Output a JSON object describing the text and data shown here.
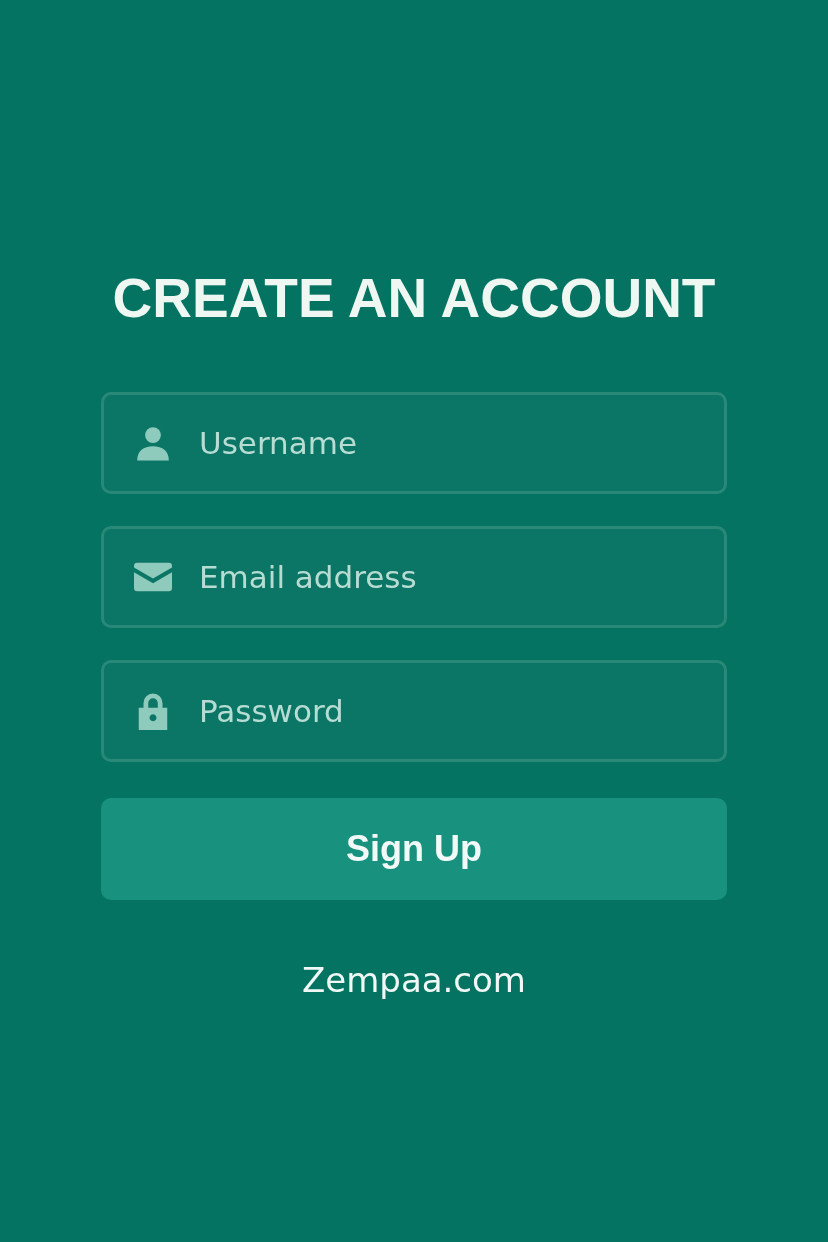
{
  "title": "CREATE AN ACCOUNT",
  "fields": [
    {
      "kind": "user",
      "placeholder": "Username"
    },
    {
      "kind": "mail",
      "placeholder": "Email address"
    },
    {
      "kind": "lock",
      "placeholder": "Password"
    }
  ],
  "button": "Sign Up",
  "footer": "Zempaa.com"
}
